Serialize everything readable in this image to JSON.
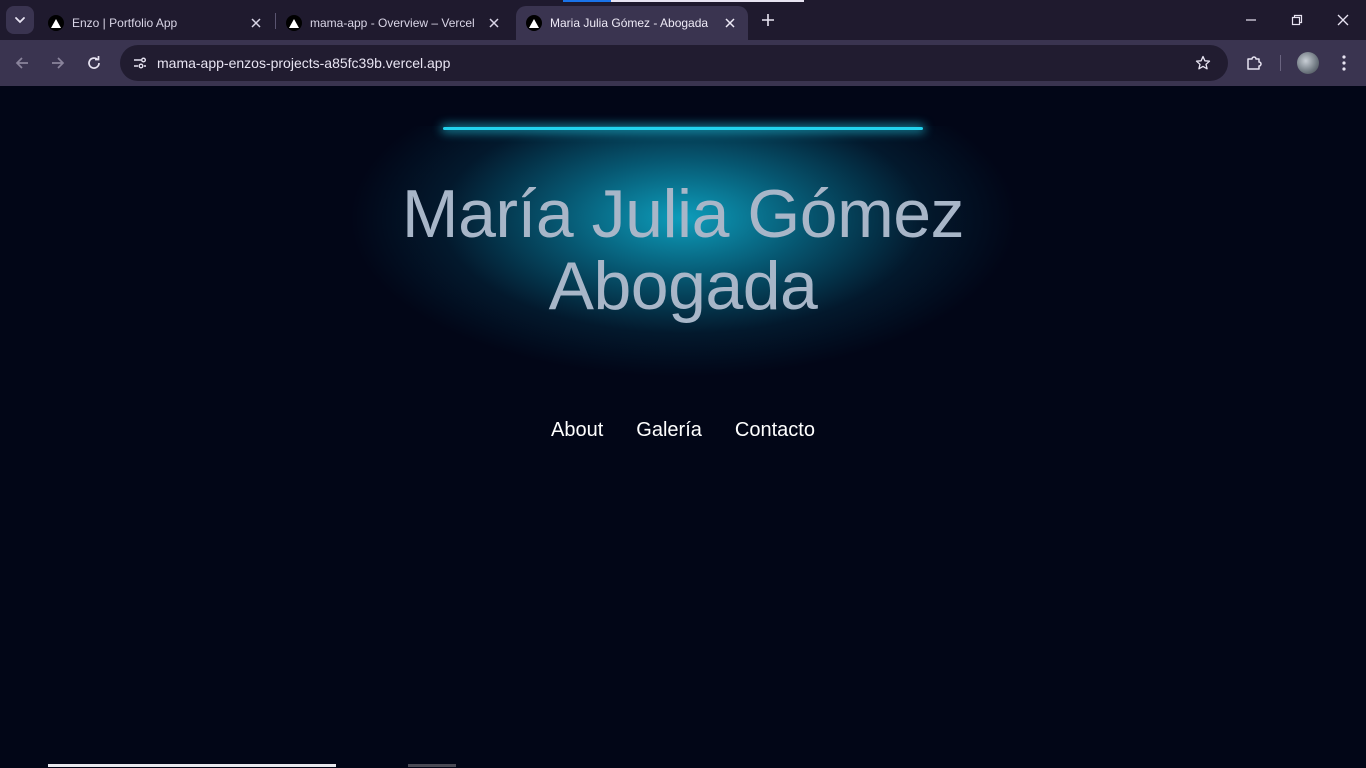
{
  "browser": {
    "tabs": [
      {
        "title": "Enzo | Portfolio App",
        "active": false
      },
      {
        "title": "mama-app - Overview – Vercel",
        "active": false
      },
      {
        "title": "Maria Julia Gómez - Abogada",
        "active": true
      }
    ],
    "url": "mama-app-enzos-projects-a85fc39b.vercel.app",
    "icons": {
      "tab_search": "chevron-down-icon",
      "favicon": "vercel-triangle-icon",
      "new_tab": "plus-icon",
      "back": "arrow-left-icon",
      "forward": "arrow-right-icon",
      "reload": "reload-icon",
      "site_info": "tune-icon",
      "bookmark": "star-icon",
      "extensions": "puzzle-icon",
      "menu": "kebab-icon"
    },
    "colors": {
      "tabbar": "#1f1a2e",
      "toolbar": "#3a3450",
      "omnibox": "#211c30"
    }
  },
  "hero": {
    "name": "María Julia Gómez",
    "role": "Abogada",
    "colors": {
      "accent": "#22d3ee",
      "title": "#a8b6c8",
      "background": "#020617"
    }
  },
  "nav": {
    "items": [
      "About",
      "Galería",
      "Contacto"
    ]
  }
}
